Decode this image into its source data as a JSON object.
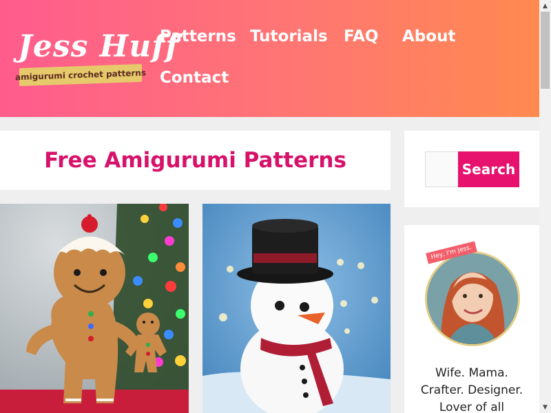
{
  "header": {
    "logo": {
      "title": "Jess Huff",
      "tagline": "amigurumi crochet patterns"
    },
    "nav": [
      {
        "label": "Patterns"
      },
      {
        "label": "Tutorials"
      },
      {
        "label": "FAQ"
      },
      {
        "label": "About"
      },
      {
        "label": "Contact"
      }
    ]
  },
  "main": {
    "page_title": "Free Amigurumi Patterns"
  },
  "sidebar": {
    "search": {
      "input_value": "",
      "button_label": "Search"
    },
    "about": {
      "hey_tag": "Hey, I'm Jess.",
      "bio_lines": [
        "Wife. Mama.",
        "Crafter. Designer.",
        "Lover of all"
      ]
    }
  },
  "colors": {
    "header_gradient_start": "#ff5c8d",
    "header_gradient_end": "#ff8a4f",
    "accent": "#e6126e",
    "title": "#d6126a"
  },
  "icons": {
    "scroll_up": "triangle-up",
    "scroll_down": "triangle-down"
  }
}
